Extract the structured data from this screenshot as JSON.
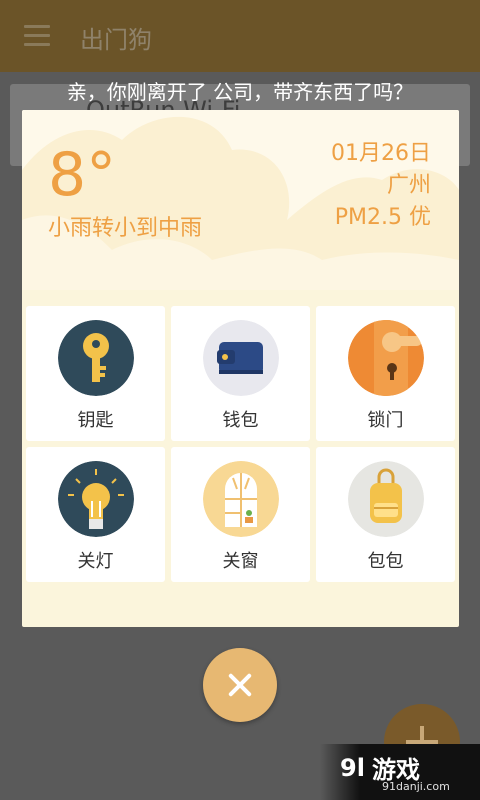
{
  "app": {
    "title": "出门狗"
  },
  "background_card": {
    "text": "OutRun Wi-Fi"
  },
  "prompt": "亲，你刚离开了 公司，带齐东西了吗？",
  "weather": {
    "temperature": "8°",
    "condition": "小雨转小到中雨",
    "date": "01月26日",
    "city": "广州",
    "air_quality": "PM2.5 优"
  },
  "checklist": [
    {
      "label": "钥匙",
      "icon": "key-icon"
    },
    {
      "label": "钱包",
      "icon": "wallet-icon"
    },
    {
      "label": "锁门",
      "icon": "door-lock-icon"
    },
    {
      "label": "关灯",
      "icon": "light-bulb-icon"
    },
    {
      "label": "关窗",
      "icon": "window-icon"
    },
    {
      "label": "包包",
      "icon": "backpack-icon"
    }
  ],
  "watermark": {
    "brand": "游戏",
    "url": "91danji.com"
  },
  "colors": {
    "accent": "#eea044",
    "fab": "#e7b872",
    "dialog_bg": "#fbf5dc"
  }
}
